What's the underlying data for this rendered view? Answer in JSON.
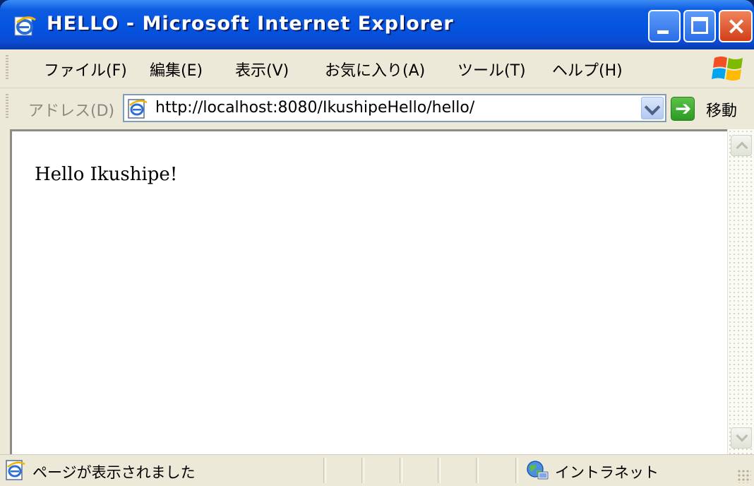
{
  "window": {
    "title": "HELLO - Microsoft Internet Explorer",
    "icon": "ie-icon",
    "controls": {
      "minimize": "minimize-icon",
      "maximize": "maximize-icon",
      "close": "×"
    }
  },
  "menubar": {
    "items": [
      {
        "label": "ファイル(F)"
      },
      {
        "label": "編集(E)"
      },
      {
        "label": "表示(V)"
      },
      {
        "label": "お気に入り(A)"
      },
      {
        "label": "ツール(T)"
      },
      {
        "label": "ヘルプ(H)"
      }
    ],
    "logo": "windows-logo"
  },
  "addressbar": {
    "label": "アドレス(D)",
    "url": "http://localhost:8080/IkushipeHello/hello/",
    "go_label": "移動",
    "go_arrow": "➔"
  },
  "content": {
    "text": "Hello Ikushipe!"
  },
  "statusbar": {
    "text": "ページが表示されました",
    "zone": "イントラネット"
  },
  "colors": {
    "titlebar": "#0454e0",
    "chrome": "#ece9d8",
    "close_button": "#d23e17",
    "go_button": "#2b9a23"
  }
}
